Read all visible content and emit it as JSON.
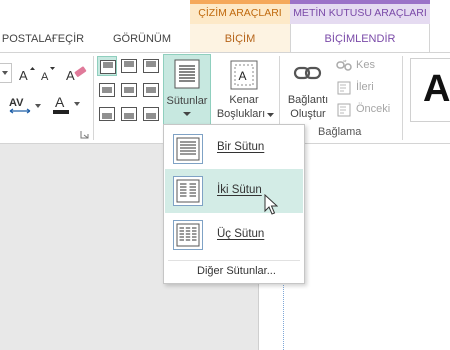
{
  "contextual": {
    "drawing_tools": "ÇİZİM ARAÇLARI",
    "textbox_tools": "METİN KUTUSU ARAÇLARI",
    "drawing_color": "#fde9c8",
    "drawing_text_color": "#c06a0e",
    "textbox_color": "#e5dbf1",
    "textbox_text_color": "#7a4aa8"
  },
  "tabs": {
    "mailings": "POSTALAҒEÇİR",
    "view": "GÖRÜNÜM",
    "format_drawing": "BİÇİM",
    "format_textbox": "BİÇİMLENDİR"
  },
  "ribbon": {
    "columns_label": "Sütunlar",
    "margins_label_1": "Kenar",
    "margins_label_2": "Boşlukları",
    "create_link_1": "Bağlantı",
    "create_link_2": "Oluştur",
    "break_link": "Kes",
    "next": "İleri",
    "previous": "Önceki",
    "linking_group": "Bağlama",
    "big_letter": "A"
  },
  "columns_menu": {
    "items": [
      {
        "label": "Bir Sütun",
        "accel": "B"
      },
      {
        "label": "İki Sütun",
        "accel": "İ"
      },
      {
        "label": "Üç Sütun",
        "accel": "Ü"
      }
    ],
    "more": "Diğer Sütunlar...",
    "hovered_index": 1
  }
}
